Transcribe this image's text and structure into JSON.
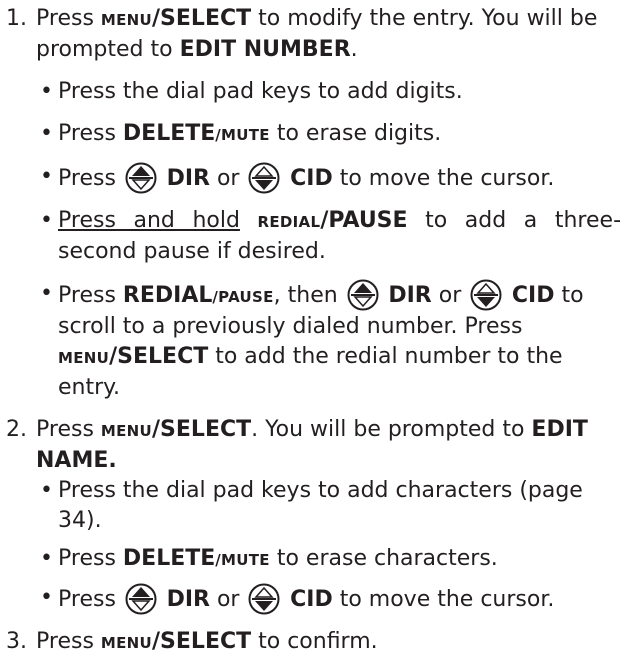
{
  "steps": [
    {
      "number": "1.",
      "parts": [
        "Press ",
        "MENU",
        "/SELECT",
        " to modify the entry. You will be prompted to ",
        "EDIT NUMBER",
        "."
      ],
      "bullets": {
        "b1": {
          "dot": "•",
          "parts": [
            "Press the dial pad keys to add digits."
          ]
        },
        "b2": {
          "dot": "•",
          "parts": [
            "Press ",
            "DELETE",
            "/MUTE",
            " to erase digits."
          ]
        },
        "b3": {
          "dot": "•",
          "parts": [
            "Press ",
            " DIR",
            " or ",
            " CID",
            " to move the cursor."
          ]
        },
        "b4": {
          "dot": "•",
          "parts": [
            "Press and hold",
            " ",
            "REDIAL",
            "/PAUSE",
            " to add a three-second pause if desired."
          ]
        },
        "b5": {
          "dot": "•",
          "parts": [
            "Press ",
            "REDIAL",
            "/PAUSE",
            ", then ",
            " DIR",
            " or ",
            " CID",
            " to scroll to a previously dialed number. Press ",
            "MENU",
            "/SELECT",
            " to add the redial number to the entry."
          ]
        }
      }
    },
    {
      "number": "2.",
      "parts": [
        "Press ",
        "MENU",
        "/SELECT",
        ". You will be prompted to ",
        "EDIT NAME."
      ],
      "bullets": {
        "b1": {
          "dot": "•",
          "parts": [
            "Press the dial pad keys to add characters (page 34)."
          ]
        },
        "b2": {
          "dot": "•",
          "parts": [
            "Press ",
            "DELETE",
            "/MUTE",
            " to erase characters."
          ]
        },
        "b3": {
          "dot": "•",
          "parts": [
            "Press ",
            " DIR",
            " or ",
            " CID",
            " to move the cursor."
          ]
        }
      }
    },
    {
      "number": "3.",
      "parts": [
        "Press ",
        "MENU",
        "/SELECT",
        " to confirm."
      ]
    }
  ],
  "icons": {
    "dir_key": "dir-key-icon",
    "cid_key": "cid-key-icon"
  },
  "colors": {
    "text": "#231f20",
    "icon_stroke": "#231f20",
    "icon_fill": "#231f20"
  }
}
